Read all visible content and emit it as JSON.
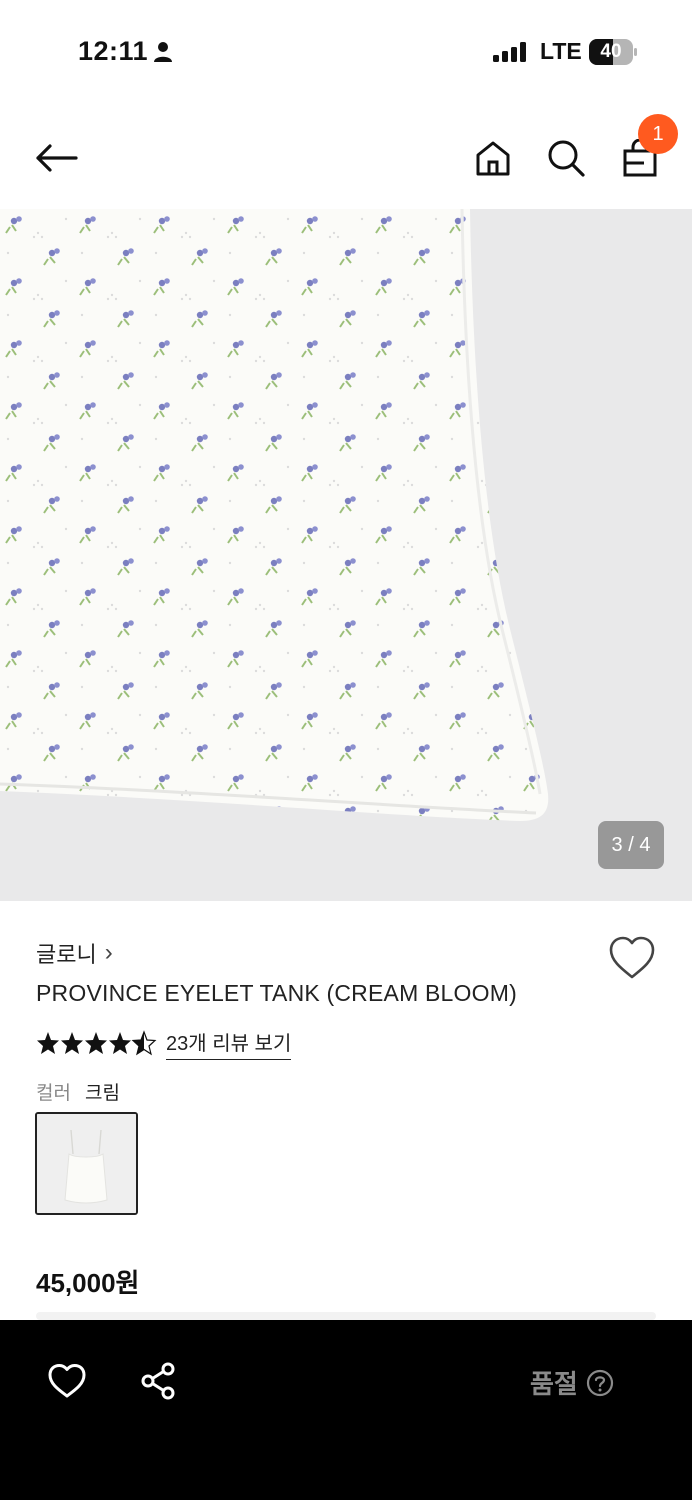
{
  "status_bar": {
    "time": "12:11",
    "network": "LTE",
    "battery": "40"
  },
  "nav": {
    "cart_count": "1"
  },
  "gallery": {
    "counter": "3 / 4"
  },
  "product": {
    "brand": "글로니",
    "brand_chevron": "›",
    "name": "PROVINCE EYELET TANK (CREAM BLOOM)",
    "rating": 4.5,
    "review_link": "23개 리뷰 보기",
    "color_label": "컬러",
    "color_value": "크림",
    "price": "45,000원"
  },
  "bottom_bar": {
    "status_label": "품절"
  },
  "colors": {
    "badge": "#ff5a1f",
    "background_image": "#e9e9ea",
    "bottom_bar": "#000000",
    "soldout_text": "#8a8a8a"
  }
}
